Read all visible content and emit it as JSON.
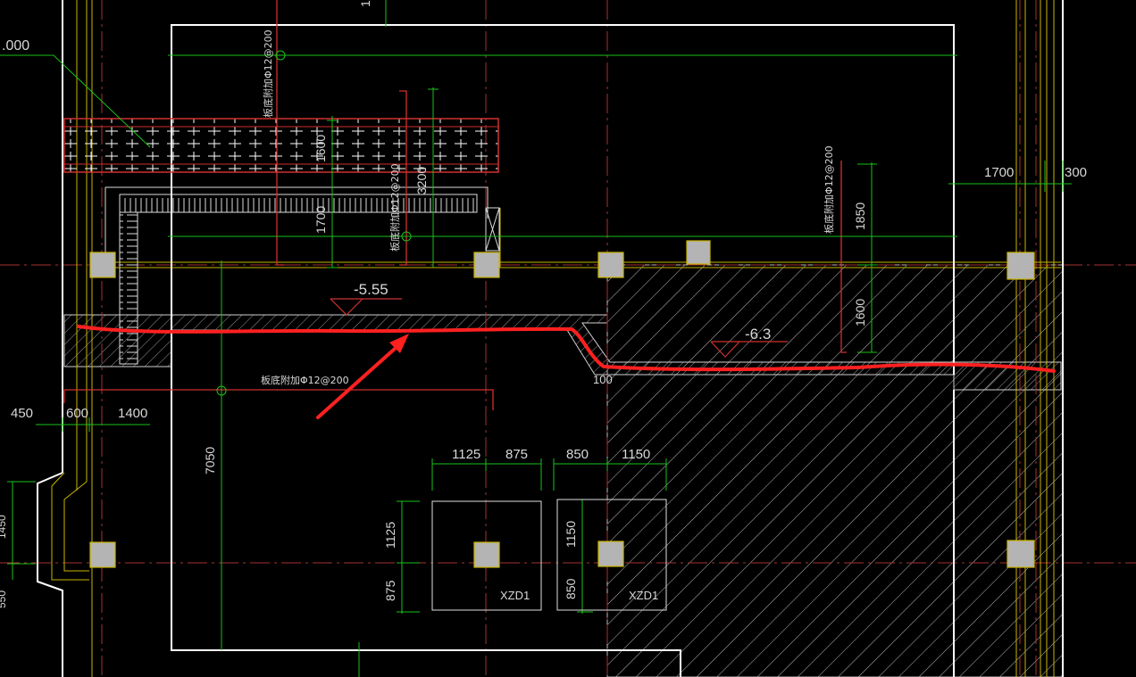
{
  "drawing": {
    "colors": {
      "background": "#000000",
      "axis": "#b03030",
      "wall": "#ffffff",
      "dimension": "#19c219",
      "yellow": "#c8b400",
      "red_annotation": "#ff2020",
      "pile": "#b4b4b4",
      "hatch": "#d0d0d0"
    },
    "top_left_elevation": ".000",
    "elevations": [
      {
        "id": "elev-1",
        "text": "-5.55"
      },
      {
        "id": "elev-2",
        "text": "-6.3"
      }
    ],
    "dimensions": [
      {
        "id": "d-1700-top",
        "text": "1700"
      },
      {
        "id": "d-300-top",
        "text": "300"
      },
      {
        "id": "d-1850",
        "text": "1850"
      },
      {
        "id": "d-1600",
        "text": "1600"
      },
      {
        "id": "d-1600b",
        "text": "1600"
      },
      {
        "id": "d-3200",
        "text": "3200"
      },
      {
        "id": "d-1700-left",
        "text": "1700"
      },
      {
        "id": "d-450",
        "text": "450"
      },
      {
        "id": "d-600",
        "text": "600"
      },
      {
        "id": "d-1400",
        "text": "1400"
      },
      {
        "id": "d-7050",
        "text": "7050"
      },
      {
        "id": "d-1125-h",
        "text": "1125"
      },
      {
        "id": "d-875-h",
        "text": "875"
      },
      {
        "id": "d-850-h",
        "text": "850"
      },
      {
        "id": "d-1150-h",
        "text": "1150"
      },
      {
        "id": "d-1125-v",
        "text": "1125"
      },
      {
        "id": "d-875-v",
        "text": "875"
      },
      {
        "id": "d-1150-v",
        "text": "1150"
      },
      {
        "id": "d-850-v",
        "text": "850"
      },
      {
        "id": "d-100",
        "text": "100"
      },
      {
        "id": "d-1450",
        "text": "1450"
      },
      {
        "id": "d-550",
        "text": "550"
      },
      {
        "id": "d-top-cut",
        "text": "1"
      }
    ],
    "rebar_notes": [
      {
        "id": "rebar-1",
        "text": "板底附加Φ12@200"
      },
      {
        "id": "rebar-2",
        "text": "板底附加Φ12@200"
      },
      {
        "id": "rebar-3",
        "text": "板底附加Φ12@200"
      },
      {
        "id": "rebar-4",
        "text": "板底附加Φ12@200"
      }
    ],
    "pile_caps": [
      {
        "id": "xzd-1",
        "text": "XZD1"
      },
      {
        "id": "xzd-2",
        "text": "XZD1"
      }
    ]
  }
}
